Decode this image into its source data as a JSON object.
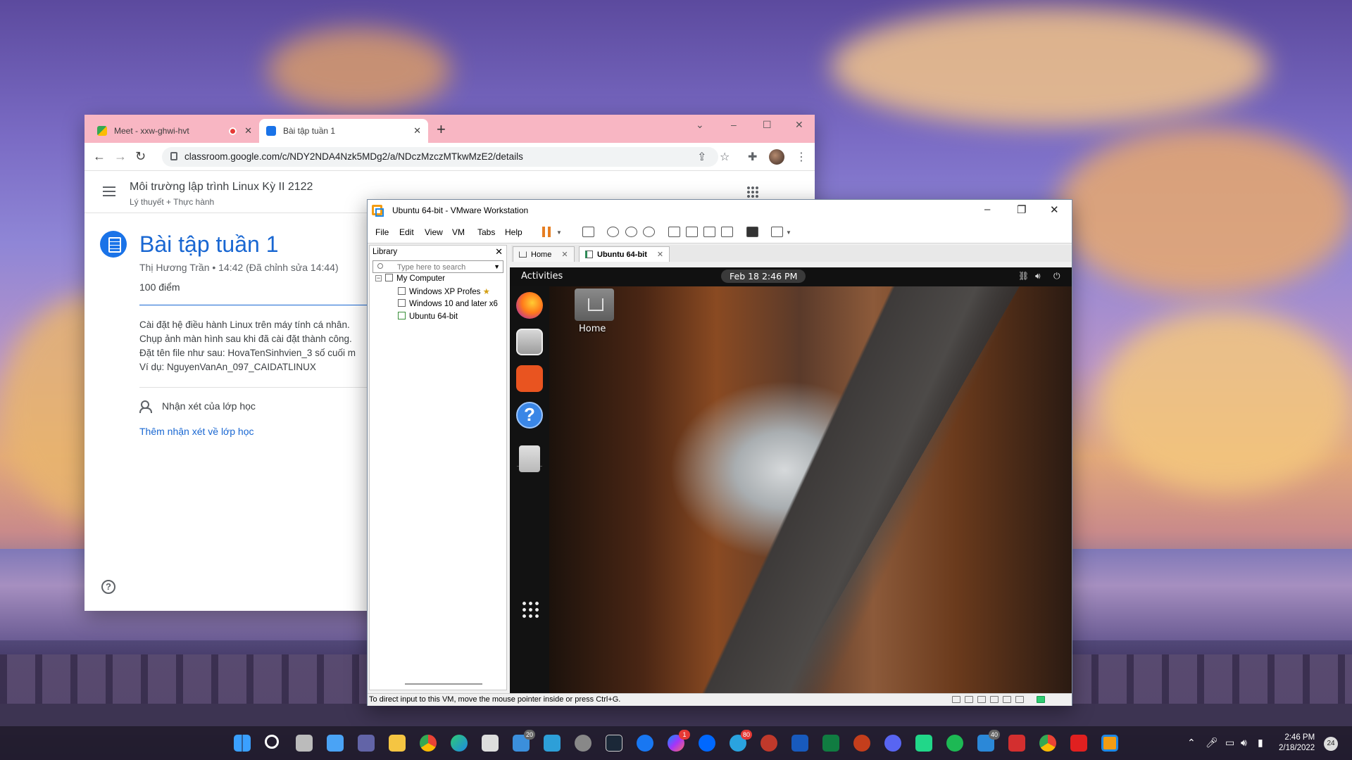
{
  "chrome": {
    "tabs": [
      {
        "label": "Meet - xxw-ghwi-hvt"
      },
      {
        "label": "Bài tập tuần 1"
      }
    ],
    "new_tab": "+",
    "url": "classroom.google.com/c/NDY2NDA4Nzk5MDg2/a/NDczMzczMTkwMzE2/details",
    "window_controls": {
      "minimize": "–",
      "maximize": "☐",
      "close": "✕",
      "dropdown": "⌄"
    }
  },
  "classroom": {
    "course_title": "Môi trường lập trình Linux Kỳ II 2122",
    "course_subtitle": "Lý thuyết + Thực hành",
    "assignment_title": "Bài tập tuần 1",
    "meta": "Thị Hương Trần • 14:42 (Đã chỉnh sửa 14:44)",
    "points": "100 điểm",
    "description": [
      "Cài đặt hệ điều hành Linux trên máy tính cá nhân.",
      "Chụp ảnh màn hình sau khi đã cài đặt thành công.",
      "Đặt tên file như sau: HovaTenSinhvien_3 số cuối m",
      "Ví dụ: NguyenVanAn_097_CAIDATLINUX"
    ],
    "class_comments_label": "Nhận xét của lớp học",
    "add_class_comment": "Thêm nhận xét về lớp học",
    "help": "?"
  },
  "vmware": {
    "title": "Ubuntu 64-bit - VMware Workstation",
    "menu": [
      "File",
      "Edit",
      "View",
      "VM",
      "Tabs",
      "Help"
    ],
    "library": {
      "header": "Library",
      "search_placeholder": "Type here to search",
      "tree": [
        {
          "label": "My Computer"
        },
        {
          "label": "Windows XP Profes"
        },
        {
          "label": "Windows 10 and later x6"
        },
        {
          "label": "Ubuntu 64-bit"
        }
      ]
    },
    "tabs": [
      {
        "label": "Home"
      },
      {
        "label": "Ubuntu 64-bit"
      }
    ],
    "status_text": "To direct input to this VM, move the mouse pointer inside or press Ctrl+G."
  },
  "ubuntu": {
    "activities": "Activities",
    "clock": "Feb 18  2:46 PM",
    "desktop_icon_label": "Home",
    "dock": [
      "firefox",
      "files",
      "ubuntu-software",
      "help",
      "trash",
      "show-applications"
    ]
  },
  "taskbar": {
    "mail_badge": "20",
    "messenger_badge": "1",
    "telegram_badge": "80",
    "tray_badge": "40",
    "time": "2:46 PM",
    "date": "2/18/2022",
    "notifications": "24"
  }
}
